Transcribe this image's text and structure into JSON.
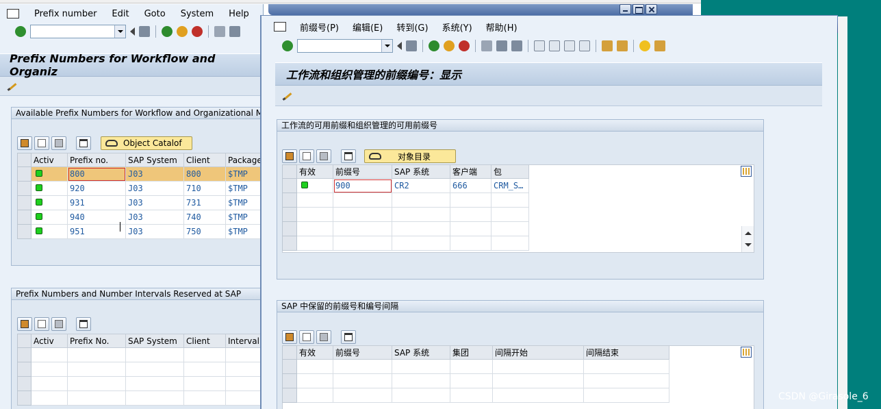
{
  "back_window": {
    "menu": [
      "Prefix number",
      "Edit",
      "Goto",
      "System",
      "Help"
    ],
    "title": "Prefix Numbers for Workflow and Organiz",
    "section1_title": "Available Prefix Numbers for Workflow and Organizational Manage",
    "object_catalog_label": "Object Catalof",
    "grid1_headers": [
      "Activ",
      "Prefix no.",
      "SAP System",
      "Client",
      "Package"
    ],
    "grid1_rows": [
      {
        "prefix": "800",
        "system": "J03",
        "client": "800",
        "package": "$TMP"
      },
      {
        "prefix": "920",
        "system": "J03",
        "client": "710",
        "package": "$TMP"
      },
      {
        "prefix": "931",
        "system": "J03",
        "client": "731",
        "package": "$TMP"
      },
      {
        "prefix": "940",
        "system": "J03",
        "client": "740",
        "package": "$TMP"
      },
      {
        "prefix": "951",
        "system": "J03",
        "client": "750",
        "package": "$TMP"
      }
    ],
    "section2_title": "Prefix Numbers and Number Intervals Reserved at SAP",
    "grid2_headers": [
      "Activ",
      "Prefix No.",
      "SAP System",
      "Client",
      "Interval S"
    ]
  },
  "front_window": {
    "menu": [
      "前缀号(P)",
      "编辑(E)",
      "转到(G)",
      "系统(Y)",
      "帮助(H)"
    ],
    "title": "工作流和组织管理的前缀编号：显示",
    "section1_title": "工作流的可用前缀和组织管理的可用前缀号",
    "object_catalog_label": "对象目录",
    "grid1_headers": [
      "有效",
      "前缀号",
      "SAP 系统",
      "客户端",
      "包"
    ],
    "grid1_rows": [
      {
        "prefix": "900",
        "system": "CR2",
        "client": "666",
        "package": "CRM_S…"
      }
    ],
    "section2_title": "SAP 中保留的前缀号和编号间隔",
    "grid2_headers": [
      "有效",
      "前缀号",
      "SAP 系统",
      "集团",
      "间隔开始",
      "间隔结束"
    ]
  },
  "watermark": "CSDN @Girasole_6",
  "colors": {
    "highlight_row": "#efc67a",
    "teal_desktop": "#007f7c",
    "value_text": "#1f5aa0"
  }
}
